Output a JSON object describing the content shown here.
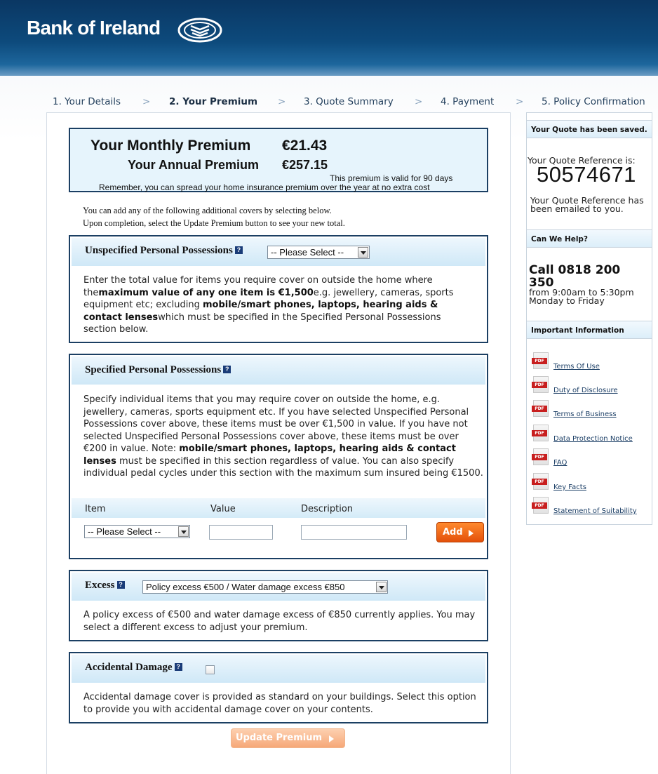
{
  "brand": {
    "name": "Bank of Ireland",
    "primary_color": "#0d4a7c",
    "accent_color": "#e4500a"
  },
  "steps": [
    {
      "label": "1. Your Details"
    },
    {
      "label": "2. Your Premium"
    },
    {
      "label": "3. Quote Summary"
    },
    {
      "label": "4. Payment"
    },
    {
      "label": "5. Policy Confirmation"
    }
  ],
  "step_separator": ">",
  "premium": {
    "monthly_label": "Your Monthly Premium",
    "monthly_value": "€21.43",
    "annual_label": "Your Annual Premium",
    "annual_value": "€257.15",
    "validity_note": "This premium is valid for 90 days",
    "spread_note": "Remember, you can spread your home insurance premium over the year at no extra cost"
  },
  "intro": {
    "line1": "You can add any of the following additional covers by selecting below.",
    "line2": "Upon completion, select the Update Premium button to see your new total."
  },
  "help_glyph": "?",
  "unspecified": {
    "title": "Unspecified Personal Possessions",
    "select_value": "-- Please Select --",
    "text_1": "Enter the total value for items you require cover on outside the home where the",
    "text_bold_1": "maximum value of any one item is €1,500",
    "text_2": "e.g. jewellery, cameras, sports equipment etc; excluding ",
    "text_bold_2": "mobile/smart phones, laptops, hearing aids & contact lenses",
    "text_3": "which must be specified in the Specified Personal Possessions section below."
  },
  "specified": {
    "title": "Specified Personal Possessions",
    "text_1": "Specify individual items that you may require cover on outside the home, e.g. jewellery, cameras, sports equipment etc. If you have selected Unspecified Personal Possessions cover above, these items must be over €1,500 in value. If you have not selected Unspecified Personal Possessions cover above, these items must be over €200 in value. Note: ",
    "text_bold": "mobile/smart phones, laptops, hearing aids & contact lenses",
    "text_2": " must be specified in this section regardless of value. You can also specify individual pedal cycles under this section with the maximum sum insured being €1500.",
    "col_item": "Item",
    "col_value": "Value",
    "col_description": "Description",
    "item_select_value": "-- Please Select --",
    "value_input": "",
    "description_input": "",
    "add_label": "Add"
  },
  "excess": {
    "title": "Excess",
    "select_value": "Policy excess €500 / Water damage excess €850",
    "text": "A policy excess of €500 and water damage excess of €850 currently applies. You may select a different excess to adjust your premium."
  },
  "accidental": {
    "title": "Accidental Damage",
    "checked": false,
    "text": "Accidental damage cover is provided as standard on your buildings. Select this option to provide you with accidental damage cover on your contents."
  },
  "update_label": "Update Premium",
  "sidebar": {
    "saved_heading": "Your Quote has been saved.",
    "ref_label": "Your Quote Reference is:",
    "ref_number": "50574671",
    "emailed_line1": "Your Quote Reference has",
    "emailed_line2": "been emailed to you.",
    "help_heading": "Can We Help?",
    "call_line1": "Call 0818 200",
    "call_line2": "350",
    "hours_line1": "from 9:00am to 5:30pm",
    "hours_line2": "Monday to Friday",
    "info_heading": "Important Information",
    "docs": [
      {
        "label": "Terms Of Use",
        "icon": "pdf-icon"
      },
      {
        "label": "Duty of Disclosure",
        "icon": "pdf-icon"
      },
      {
        "label": "Terms of Business",
        "icon": "pdf-icon"
      },
      {
        "label": "Data Protection Notice",
        "icon": "pdf-icon"
      },
      {
        "label": "FAQ",
        "icon": "pdf-icon"
      },
      {
        "label": "Key Facts",
        "icon": "pdf-icon"
      },
      {
        "label": "Statement of Suitability",
        "icon": "pdf-icon"
      }
    ]
  }
}
